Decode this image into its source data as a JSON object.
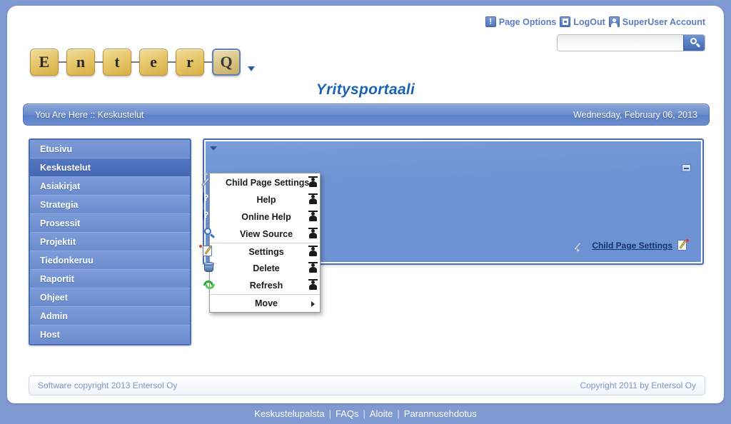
{
  "header": {
    "utility_links": [
      {
        "label": "Page Options",
        "icon": "exclamation-icon"
      },
      {
        "label": "LogOut",
        "icon": "logout-door-icon"
      },
      {
        "label": "SuperUser Account",
        "icon": "user-icon"
      }
    ],
    "search": {
      "value": "",
      "placeholder": "",
      "button_icon": "search-icon"
    },
    "logo": {
      "letters": [
        "E",
        "n",
        "t",
        "e",
        "r"
      ],
      "accent_letter": "Q",
      "caret_icon": "chevron-down-icon"
    },
    "portal_title": "Yritysportaali"
  },
  "breadcrumb": {
    "text": "You Are Here :: Keskustelut",
    "date": "Wednesday, February 06, 2013"
  },
  "sidebar": {
    "items": [
      {
        "label": "Etusivu",
        "selected": false
      },
      {
        "label": "Keskustelut",
        "selected": true
      },
      {
        "label": "Asiakirjat",
        "selected": false
      },
      {
        "label": "Strategia",
        "selected": false
      },
      {
        "label": "Prosessit",
        "selected": false
      },
      {
        "label": "Projektit",
        "selected": false
      },
      {
        "label": "Tiedonkeruu",
        "selected": false
      },
      {
        "label": "Raportit",
        "selected": false
      },
      {
        "label": "Ohjeet",
        "selected": false
      },
      {
        "label": "Admin",
        "selected": false
      },
      {
        "label": "Host",
        "selected": false
      }
    ]
  },
  "content_pane": {
    "caret_icon": "chevron-down-icon",
    "minimize_icon": "minimize-icon",
    "child_page_settings_label": "Child Page Settings",
    "left_icon": "pencil-icon",
    "right_icon": "edit-notepad-icon"
  },
  "context_menu": {
    "items": [
      {
        "label": "Child Page Settings",
        "left_icon": "pencil-icon",
        "right_icon": "person-icon",
        "separator_above": false,
        "submenu": false
      },
      {
        "label": "Help",
        "left_icon": "help-icon",
        "right_icon": "person-icon",
        "separator_above": false,
        "submenu": false
      },
      {
        "label": "Online Help",
        "left_icon": "help-icon",
        "right_icon": "person-icon",
        "separator_above": false,
        "submenu": false
      },
      {
        "label": "View Source",
        "left_icon": "magnify-icon",
        "right_icon": "person-icon",
        "separator_above": false,
        "submenu": false
      },
      {
        "label": "Settings",
        "left_icon": "edit-notepad-icon",
        "right_icon": "person-icon",
        "separator_above": true,
        "submenu": false
      },
      {
        "label": "Delete",
        "left_icon": "trash-icon",
        "right_icon": "person-icon",
        "separator_above": false,
        "submenu": false
      },
      {
        "label": "Refresh",
        "left_icon": "refresh-icon",
        "right_icon": "person-icon",
        "separator_above": false,
        "submenu": false
      },
      {
        "label": "Move",
        "left_icon": "none",
        "right_icon": "none",
        "separator_above": true,
        "submenu": true
      }
    ]
  },
  "footer": {
    "left_text": "Software copyright 2013 Entersol Oy",
    "right_text": "Copyright 2011 by Entersol Oy"
  },
  "bottom_nav": {
    "links": [
      "Keskustelupalsta",
      "FAQs",
      "Aloite",
      "Parannusehdotus"
    ],
    "separator": "|"
  },
  "colors": {
    "page_background": "#7f9ad0",
    "accent_blue": "#4a6cb3",
    "content_panel": "#6e93d4",
    "selected_nav": "#4568b6",
    "nav_item": "#6b8cce",
    "title_blue": "#1a62b8",
    "logo_gold": "#e8c96f",
    "footer_text": "#7e95c4"
  }
}
